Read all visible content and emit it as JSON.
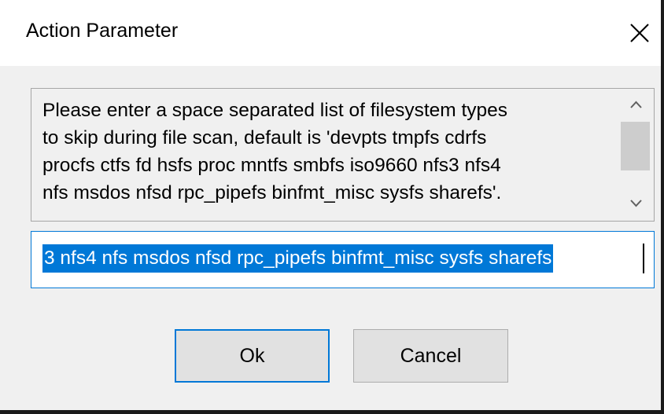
{
  "dialog": {
    "title": "Action Parameter",
    "description": "Please enter a space separated list of filesystem types\nto skip during file scan, default is 'devpts tmpfs cdrfs\nprocfs ctfs fd hsfs proc mntfs smbfs iso9660 nfs3 nfs4\nnfs msdos nfsd rpc_pipefs binfmt_misc sysfs sharefs'.",
    "input_visible_text": "3 nfs4 nfs msdos nfsd rpc_pipefs binfmt_misc sysfs sharefs",
    "input_value": "devpts tmpfs cdrfs procfs ctfs fd hsfs proc mntfs smbfs iso9660 nfs3 nfs4 nfs msdos nfsd rpc_pipefs binfmt_misc sysfs sharefs",
    "ok_label": "Ok",
    "cancel_label": "Cancel"
  },
  "icons": {
    "close": "close-icon",
    "scroll_up": "chevron-up-icon",
    "scroll_down": "chevron-down-icon"
  },
  "colors": {
    "selection": "#0078d7",
    "dialog_bg": "#f0f0f0",
    "title_bg": "#ffffff",
    "button_bg": "#e1e1e1"
  }
}
